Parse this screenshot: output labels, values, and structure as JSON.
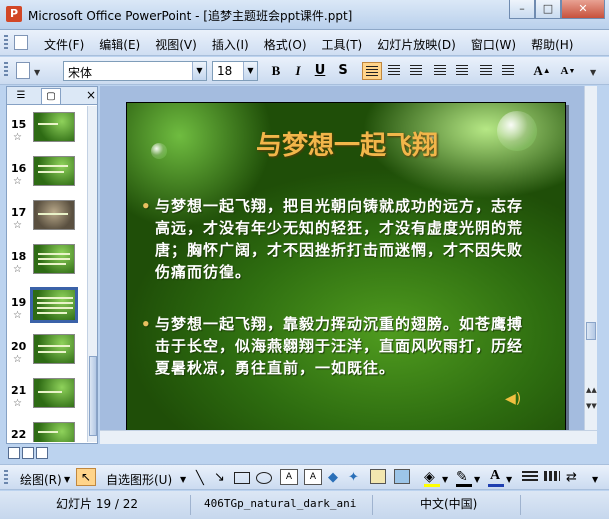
{
  "window": {
    "title": "Microsoft Office PowerPoint - [追梦主题班会ppt课件.ppt]",
    "min_label": "–",
    "max_label": "□",
    "close_label": "✕"
  },
  "menu": {
    "items": [
      "文件(F)",
      "编辑(E)",
      "视图(V)",
      "插入(I)",
      "格式(O)",
      "工具(T)",
      "幻灯片放映(D)",
      "窗口(W)",
      "帮助(H)"
    ]
  },
  "toolbar": {
    "font": "宋体",
    "size": "18",
    "bold": "B",
    "italic": "I",
    "underline": "U",
    "shadow": "S",
    "grow_font": "A",
    "shrink_font": "A"
  },
  "slides_panel": {
    "close_label": "×",
    "thumbnails": [
      {
        "number": "15"
      },
      {
        "number": "16"
      },
      {
        "number": "17"
      },
      {
        "number": "18"
      },
      {
        "number": "19",
        "selected": true
      },
      {
        "number": "20"
      },
      {
        "number": "21"
      },
      {
        "number": "22"
      }
    ]
  },
  "slide": {
    "title": "与梦想一起飞翔",
    "bullets": [
      "与梦想一起飞翔，把目光朝向铸就成功的远方，志存高远，才没有年少无知的轻狂，才没有虚度光阴的荒唐；胸怀广阔，才不因挫折打击而迷惘，才不因失败伤痛而彷徨。",
      "与梦想一起飞翔，靠毅力挥动沉重的翅膀。如苍鹰搏击于长空，似海燕翱翔于汪洋，直面风吹雨打，历经夏暑秋凉，勇往直前，一如既往。"
    ]
  },
  "drawing_toolbar": {
    "draw_label": "绘图(R)",
    "autoshape_label": "自选图形(U)"
  },
  "status": {
    "slide": "幻灯片 19 / 22",
    "design": "406TGp_natural_dark_ani",
    "language": "中文(中国)"
  }
}
